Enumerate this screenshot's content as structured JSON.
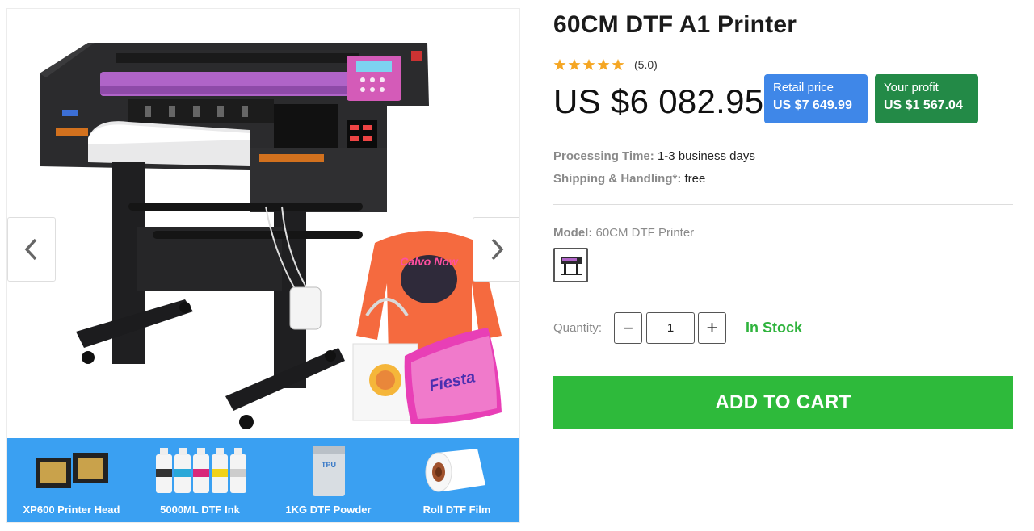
{
  "product": {
    "title": "60CM DTF A1 Printer",
    "rating_text": "(5.0)",
    "rating_value": 5,
    "price": "US $6 082.95",
    "retail": {
      "label": "Retail price",
      "value": "US $7 649.99"
    },
    "profit": {
      "label": "Your profit",
      "value": "US $1 567.04"
    },
    "processing": {
      "label": "Processing Time:",
      "value": " 1-3 business days"
    },
    "shipping": {
      "label": "Shipping & Handling*:",
      "value": " free"
    },
    "model": {
      "label": "Model:",
      "value": " 60CM DTF Printer"
    },
    "quantity": {
      "label": "Quantity:",
      "value": "1",
      "minus": "−",
      "plus": "+"
    },
    "stock_status": "In Stock",
    "add_to_cart": "ADD TO CART"
  },
  "gallery": {
    "graphic_text": {
      "sweater_print": "Calvo Now",
      "pillow_print": "Fiesta",
      "powder_bag_print": "TPU"
    },
    "accessories": [
      {
        "label": "XP600 Printer Head",
        "icon": "printer-head-icon"
      },
      {
        "label": "5000ML DTF Ink",
        "icon": "ink-bottles-icon"
      },
      {
        "label": "1KG DTF Powder",
        "icon": "powder-bag-icon"
      },
      {
        "label": "Roll DTF Film",
        "icon": "film-roll-icon"
      }
    ]
  },
  "colors": {
    "accent_green": "#2eba3b",
    "retail_blue": "#3f87e8",
    "profit_green": "#238a47",
    "strip_blue": "#3aa0f2",
    "star": "#f5a623",
    "stock_green": "#2fb33d"
  }
}
